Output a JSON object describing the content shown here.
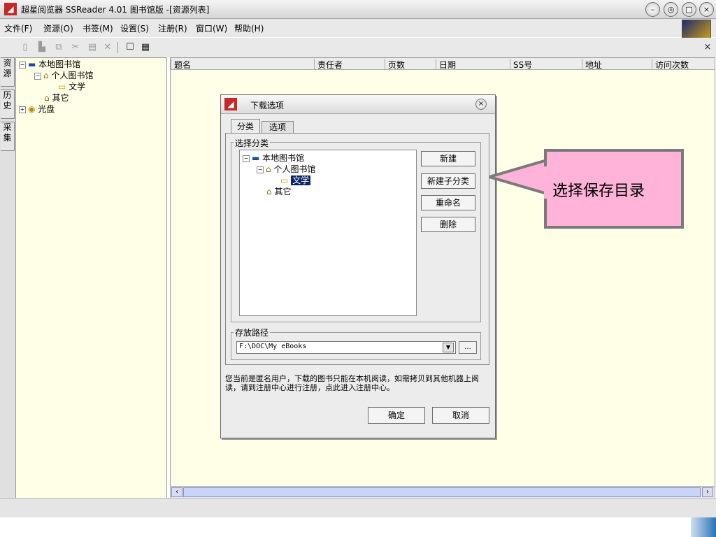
{
  "window": {
    "title": "超星阅览器 SSReader 4.01 图书馆版 -[资源列表]"
  },
  "menu": [
    "文件(F)",
    "资源(O)",
    "书签(M)",
    "设置(S)",
    "注册(R)",
    "窗口(W)",
    "帮助(H)"
  ],
  "side_tabs": [
    {
      "label": "资源"
    },
    {
      "label": "历史"
    },
    {
      "label": "采集"
    }
  ],
  "tree": [
    {
      "label": "本地图书馆",
      "expander": "⊟"
    },
    {
      "label": "个人图书馆",
      "expander": "⊟"
    },
    {
      "label": "文学"
    },
    {
      "label": "其它"
    },
    {
      "label": "光盘",
      "expander": "⊞"
    }
  ],
  "columns": [
    "题名",
    "责任者",
    "页数",
    "日期",
    "SS号",
    "地址",
    "访问次数"
  ],
  "dialog": {
    "title": "下载选项",
    "tabs": [
      "分类",
      "选项"
    ],
    "category_group_label": "选择分类",
    "tree": [
      {
        "label": "本地图书馆",
        "expander": "⊟"
      },
      {
        "label": "个人图书馆",
        "expander": "⊟"
      },
      {
        "label": "文学",
        "selected": true
      },
      {
        "label": "其它"
      }
    ],
    "buttons": [
      "新建",
      "新建子分类",
      "重命名",
      "删除"
    ],
    "path_group_label": "存放路径",
    "path_value": "F:\\DOC\\My eBooks",
    "browse_label": "...",
    "notice": "您当前是匿名用户，下载的图书只能在本机阅读，如需拷贝到其他机器上阅读，请到注册中心进行注册，点此进入注册中心。",
    "ok_label": "确定",
    "cancel_label": "取消"
  },
  "callout": {
    "text": "选择保存目录"
  }
}
